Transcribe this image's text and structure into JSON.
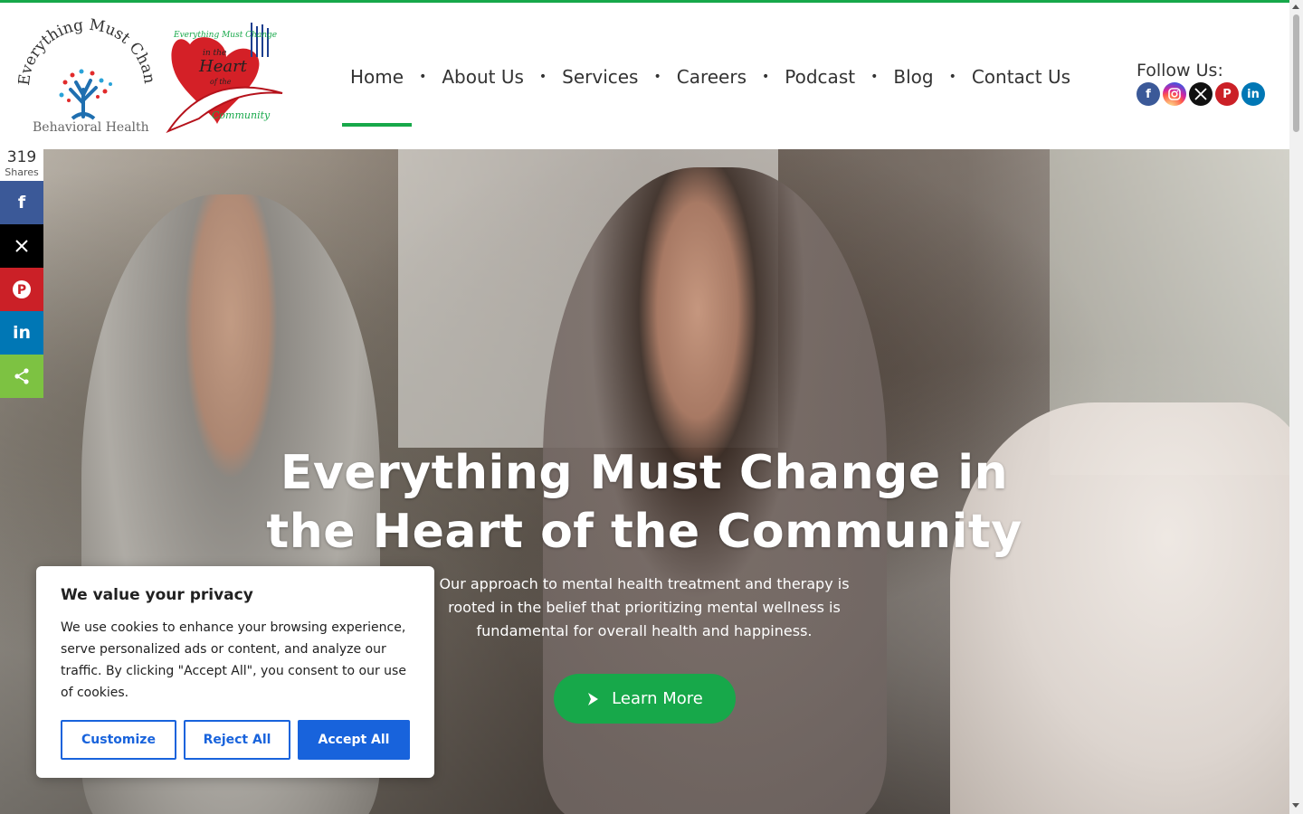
{
  "brand": {
    "logo_arc_text": "Everything Must Change",
    "logo_sub_text": "Behavioral Health",
    "heart_logo_text": "Everything Must Change in the Heart of the Community"
  },
  "nav": {
    "items": [
      {
        "label": "Home",
        "active": true
      },
      {
        "label": "About Us"
      },
      {
        "label": "Services"
      },
      {
        "label": "Careers"
      },
      {
        "label": "Podcast"
      },
      {
        "label": "Blog"
      },
      {
        "label": "Contact Us"
      }
    ],
    "separator": "•"
  },
  "follow": {
    "label": "Follow Us:",
    "icons": [
      "facebook-icon",
      "instagram-icon",
      "x-icon",
      "pinterest-icon",
      "linkedin-icon"
    ]
  },
  "share": {
    "count": "319",
    "count_label": "Shares",
    "buttons": [
      "facebook",
      "x",
      "pinterest",
      "linkedin",
      "share"
    ]
  },
  "hero": {
    "title_line1": "Everything Must Change in",
    "title_line2": "the Heart of the Community",
    "subtitle": "Our approach to mental health treatment and therapy is rooted in the belief that prioritizing mental wellness is fundamental for overall health and happiness.",
    "cta_label": "Learn More"
  },
  "cookie": {
    "title": "We value your privacy",
    "text": "We use cookies to enhance your browsing experience, serve personalized ads or content, and analyze our traffic. By clicking \"Accept All\", you consent to our use of cookies.",
    "customize_label": "Customize",
    "reject_label": "Reject All",
    "accept_label": "Accept All"
  },
  "colors": {
    "accent_green": "#17a84a",
    "cookie_blue": "#1863dc",
    "facebook": "#3b5998",
    "x": "#000000",
    "pinterest": "#cb2027",
    "linkedin": "#0077b5",
    "share": "#7dc242"
  }
}
